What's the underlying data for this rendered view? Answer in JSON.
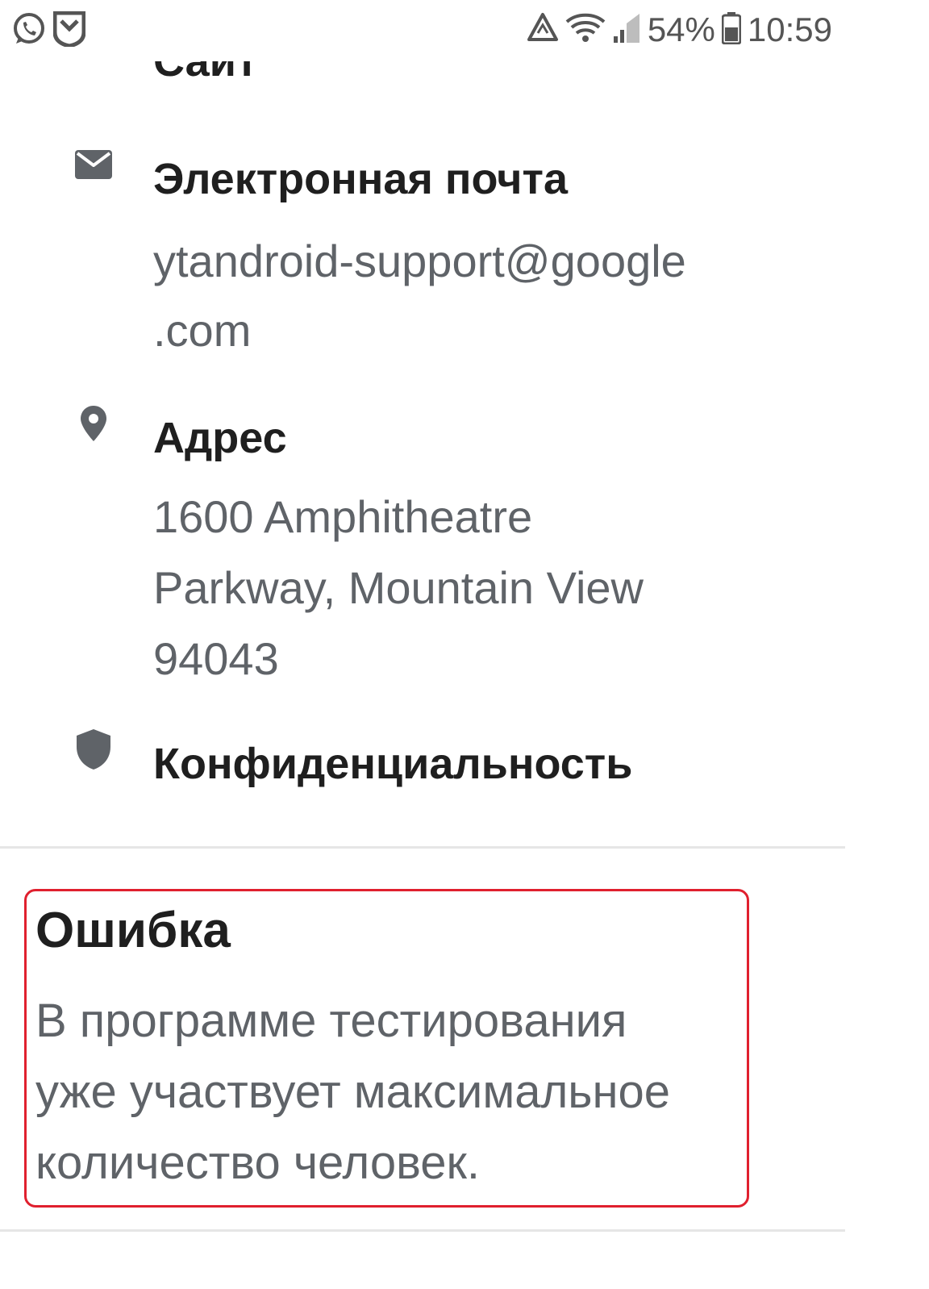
{
  "status_bar": {
    "left_icons": [
      "whatsapp-icon",
      "shield-app-icon"
    ],
    "battery_percent": "54%",
    "time": "10:59",
    "battery_level": 0.54
  },
  "developer_info": {
    "site": {
      "title": "Сайт",
      "icon": "globe-icon"
    },
    "email": {
      "title": "Электронная почта",
      "value_line1": "ytandroid-support@google",
      "value_line2": ".com",
      "icon": "mail-icon"
    },
    "address": {
      "title": "Адрес",
      "value_line1": "1600 Amphitheatre",
      "value_line2": "Parkway, Mountain View",
      "value_line3": "94043",
      "icon": "location-pin-icon"
    },
    "privacy": {
      "title": "Конфиденциальность",
      "icon": "shield-icon"
    }
  },
  "error": {
    "title": "Ошибка",
    "message_line1": "В программе тестирования",
    "message_line2": "уже участвует максимальное",
    "message_line3": "количество человек.",
    "highlight_color": "#e0202e"
  },
  "colors": {
    "title_text": "#1f1f1f",
    "secondary_text": "#5f6368",
    "icon_gray": "#5f6368",
    "divider": "#e6e6e6"
  }
}
